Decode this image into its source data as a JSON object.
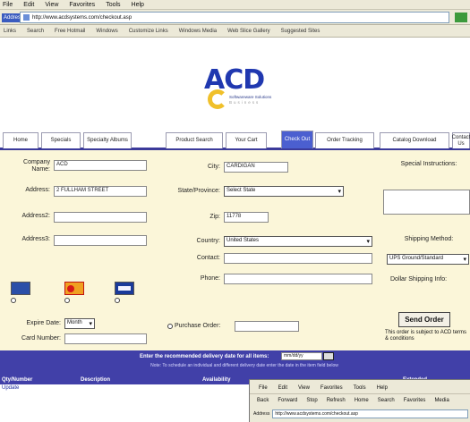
{
  "browser": {
    "menu": [
      "File",
      "Edit",
      "View",
      "Favorites",
      "Tools",
      "Help"
    ],
    "address_label": "Address",
    "address_url": "http://www.acdsystems.com/checkout.asp",
    "links": [
      "Links",
      "Search",
      "Free Hotmail",
      "Windows",
      "Customize Links",
      "Windows Media",
      "Web Slice Gallery",
      "Suggested Sites"
    ]
  },
  "logo": {
    "letters": "ACD",
    "tagline1": "Softwareware Solutions",
    "tagline2": "Business"
  },
  "tabs": [
    "Home",
    "Specials",
    "Specialty Albums",
    "Product Search",
    "Your Cart",
    "Check Out",
    "Order Tracking",
    "Catalog Download",
    "Contact Us"
  ],
  "form": {
    "company_label": "Company Name:",
    "company_value": "ACD",
    "address_label": "Address:",
    "address_value": "2 FULLHAM STREET",
    "address2_label": "Address2:",
    "address2_value": "",
    "address3_label": "Address3:",
    "address3_value": "",
    "city_label": "City:",
    "city_value": "CARDIGAN",
    "state_label": "State/Province:",
    "state_value": "Select State",
    "zip_label": "Zip:",
    "zip_value": "11778",
    "country_label": "Country:",
    "country_value": "United States",
    "contact_label": "Contact:",
    "contact_value": "",
    "phone_label": "Phone:",
    "phone_value": "",
    "special_label": "Special Instructions:",
    "shipping_label": "Shipping Method:",
    "shipping_value": "UPS Ground/Standard",
    "dollar_label": "Dollar Shipping Info:",
    "expire_label": "Expire Date:",
    "expire_value": "Month",
    "card_label": "Card Number:",
    "card_value": "",
    "purchase_label": "Purchase Order:",
    "purchase_value": "",
    "card_names": [
      "Amex",
      "Master",
      "Visa"
    ],
    "send_label": "Send Order",
    "send_note": "This order is subject to ACD terms & conditions"
  },
  "band": {
    "prompt": "Enter the recommended delivery date for all items:",
    "date_value": "mm/dd/yy",
    "note": "Note: To schedule an individual and different delivery date enter the date in the item field below",
    "col_headers": [
      "Qty/Number",
      "Description",
      "Availability",
      "Extended"
    ]
  },
  "lower": {
    "link": "Update"
  },
  "overlay_window": {
    "menu": [
      "File",
      "Edit",
      "View",
      "Favorites",
      "Tools",
      "Help"
    ],
    "toolbar": [
      "Back",
      "Forward",
      "Stop",
      "Refresh",
      "Home",
      "Search",
      "Favorites",
      "Media"
    ],
    "address_label": "Address",
    "address_url": "http://www.acdsystems.com/checkout.asp"
  },
  "colors": {
    "band": "#4140a8",
    "active_tab": "#4b5fd0",
    "form_bg": "#fbf6d9",
    "logo_blue": "#2038b0",
    "logo_yellow": "#f0c02a"
  }
}
